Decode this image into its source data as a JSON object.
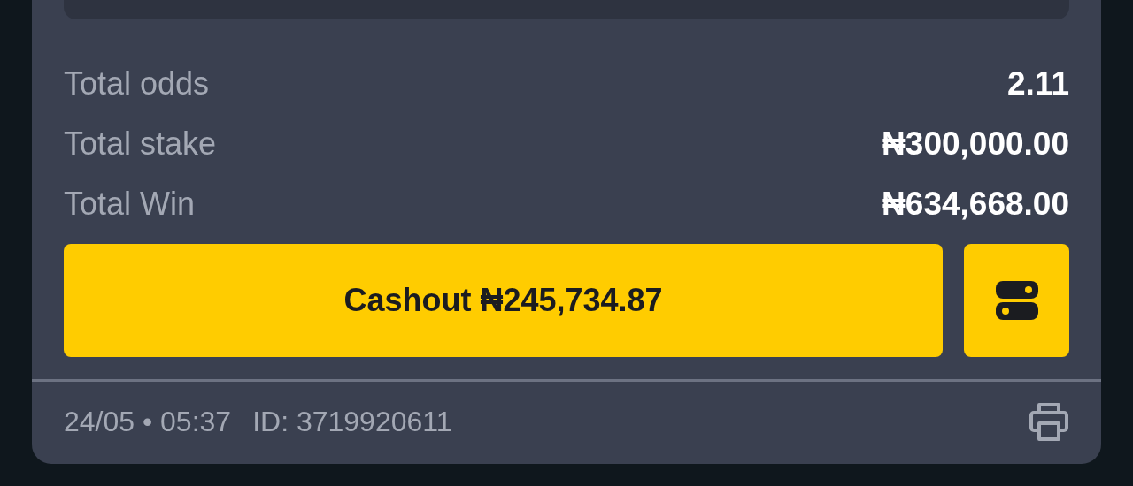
{
  "summary": [
    {
      "label": "Total odds",
      "value": "2.11"
    },
    {
      "label": "Total stake",
      "value": "₦300,000.00"
    },
    {
      "label": "Total Win",
      "value": "₦634,668.00"
    }
  ],
  "cashout_button": {
    "label": "Cashout ₦245,734.87"
  },
  "footer": {
    "datetime": "24/05 • 05:37",
    "id": "ID: 3719920611"
  }
}
